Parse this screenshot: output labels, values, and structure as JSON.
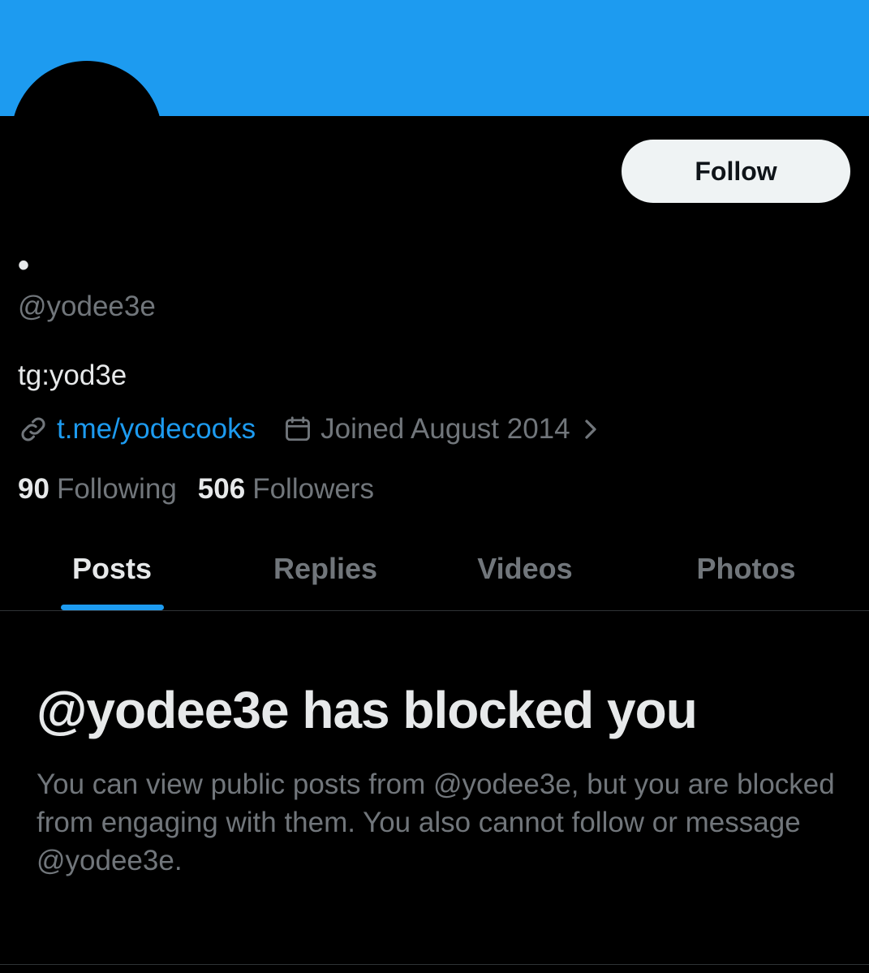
{
  "profile": {
    "display_name": "•",
    "handle": "@yodee3e",
    "bio": "tg:yod3e",
    "link": "t.me/yodecooks",
    "joined": "Joined August 2014",
    "following_count": "90",
    "following_label": "Following",
    "followers_count": "506",
    "followers_label": "Followers"
  },
  "actions": {
    "follow_label": "Follow"
  },
  "tabs": [
    {
      "label": "Posts",
      "active": true
    },
    {
      "label": "Replies",
      "active": false
    },
    {
      "label": "Videos",
      "active": false
    },
    {
      "label": "Photos",
      "active": false
    }
  ],
  "blocked": {
    "title": "@yodee3e has blocked you",
    "description": "You can view public posts from @yodee3e, but you are blocked from engaging with them. You also cannot follow or message @yodee3e."
  },
  "icons": {
    "link": "link-icon",
    "calendar": "calendar-icon",
    "chevron": "chevron-right-icon"
  },
  "colors": {
    "banner": "#1d9bf0",
    "accent": "#1d9bf0",
    "background": "#000000",
    "primary_text": "#e7e9ea",
    "secondary_text": "#71767b",
    "follow_button_bg": "#eff3f4"
  }
}
